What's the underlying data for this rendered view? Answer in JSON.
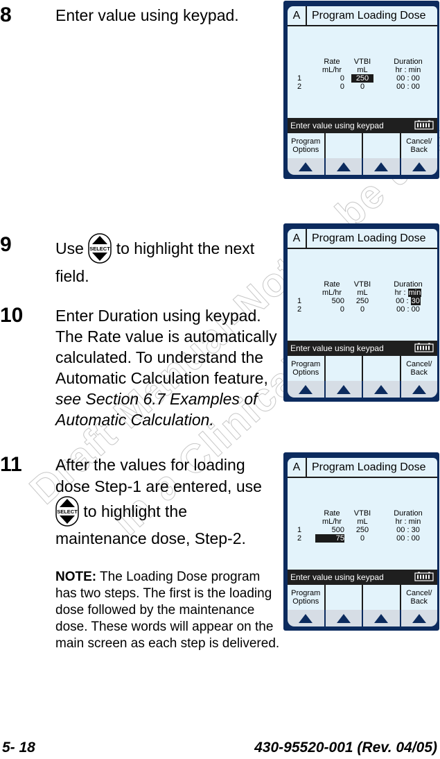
{
  "watermark": {
    "line1": "Draft Manual-Not to be used",
    "line2": "in a Clinical Setting"
  },
  "steps": [
    {
      "number": "8",
      "text": "Enter value using keypad."
    },
    {
      "number": "9",
      "text_before": "Use",
      "icon": "select-key-icon",
      "text_after": "to highlight the next field."
    },
    {
      "number": "10",
      "text": "Enter Duration using keypad. The Rate value is automatically calculated. To understand the Automatic Calculation feature,",
      "italic_text": "see Section 6.7 Examples of Automatic Calculation."
    },
    {
      "number": "11",
      "text_before": "After the values for loading dose Step-1 are entered, use",
      "icon": "select-key-icon",
      "text_after": "to highlight the maintenance dose, Step-2.",
      "note_label": "NOTE:",
      "note_text": "The Loading Dose program has two steps. The first is the loading dose followed by the maintenance dose. These words will appear on the main screen as each step is delivered."
    }
  ],
  "select_key_label": "SELECT",
  "screens": [
    {
      "channel": "A",
      "title": "Program Loading Dose",
      "headers": {
        "rate": "Rate",
        "rate_unit": "mL/hr",
        "vtbi": "VTBI",
        "vtbi_unit": "mL",
        "duration": "Duration",
        "duration_hr": "hr",
        "duration_sep": ":",
        "duration_min": "min"
      },
      "rows": [
        {
          "step": "1",
          "rate": "0",
          "vtbi": "250",
          "dur_hr": "00",
          "dur_min": "00"
        },
        {
          "step": "2",
          "rate": "0",
          "vtbi": "0",
          "dur_hr": "00",
          "dur_min": "00"
        }
      ],
      "highlighted_field": "row1.vtbi",
      "status": "Enter value using keypad",
      "softkeys": [
        "Program Options",
        "",
        "",
        "Cancel/ Back"
      ]
    },
    {
      "channel": "A",
      "title": "Program Loading Dose",
      "headers": {
        "rate": "Rate",
        "rate_unit": "mL/hr",
        "vtbi": "VTBI",
        "vtbi_unit": "mL",
        "duration": "Duration",
        "duration_hr": "hr",
        "duration_sep": ":",
        "duration_min": "min"
      },
      "rows": [
        {
          "step": "1",
          "rate": "500",
          "vtbi": "250",
          "dur_hr": "00",
          "dur_min": "30"
        },
        {
          "step": "2",
          "rate": "0",
          "vtbi": "0",
          "dur_hr": "00",
          "dur_min": "00"
        }
      ],
      "highlighted_field": "row1.dur_min",
      "status": "Enter value using keypad",
      "softkeys": [
        "Program Options",
        "",
        "",
        "Cancel/ Back"
      ]
    },
    {
      "channel": "A",
      "title": "Program Loading Dose",
      "headers": {
        "rate": "Rate",
        "rate_unit": "mL/hr",
        "vtbi": "VTBI",
        "vtbi_unit": "mL",
        "duration": "Duration",
        "duration_hr": "hr",
        "duration_sep": ":",
        "duration_min": "min"
      },
      "rows": [
        {
          "step": "1",
          "rate": "500",
          "vtbi": "250",
          "dur_hr": "00",
          "dur_min": "30"
        },
        {
          "step": "2",
          "rate": "75",
          "vtbi": "0",
          "dur_hr": "00",
          "dur_min": "00"
        }
      ],
      "highlighted_field": "row2.rate",
      "status": "Enter value using keypad",
      "softkeys": [
        "Program Options",
        "",
        "",
        "Cancel/ Back"
      ]
    }
  ],
  "footer": {
    "page": "5- 18",
    "doc_id": "430-95520-001 (Rev. 04/05)"
  },
  "colors": {
    "screen_frame": "#0c2b5e",
    "screen_bg": "#e3f3fb",
    "status_bar": "#1f1f1f",
    "softkey_arrow_bg": "#d6dde5"
  }
}
